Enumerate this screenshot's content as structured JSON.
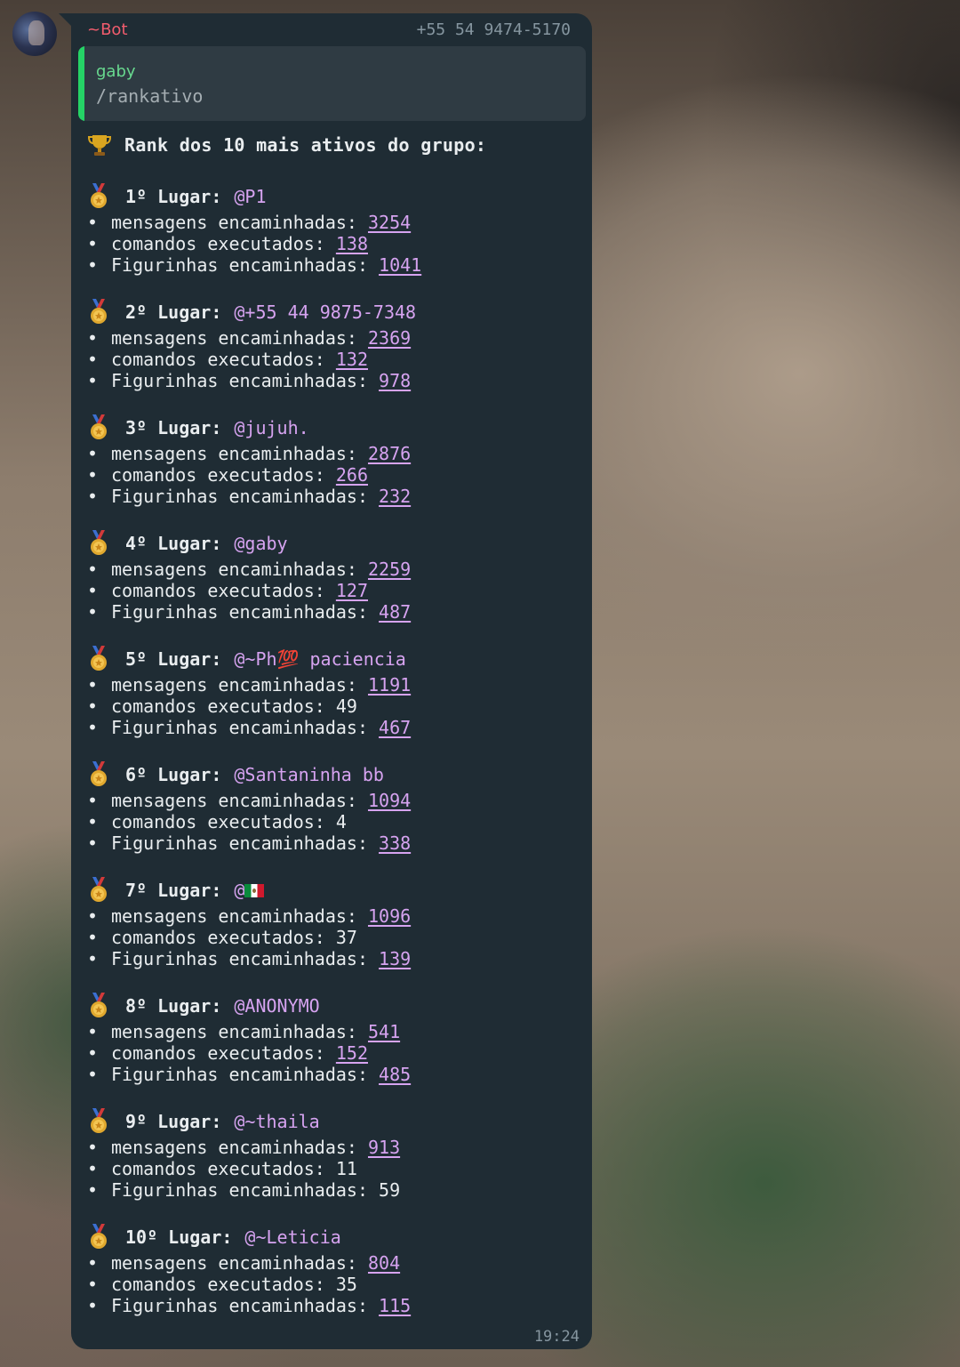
{
  "message": {
    "sender_name": "~Bot",
    "sender_phone": "+55 54 9474-5170",
    "quote": {
      "author": "gaby",
      "text": "/rankativo"
    },
    "title": "Rank dos 10 mais ativos do grupo:",
    "time": "19:24",
    "labels": {
      "messages": "mensagens encaminhadas: ",
      "commands": "comandos executados: ",
      "stickers": "Figurinhas encaminhadas: ",
      "bullet": "•"
    },
    "entries": [
      {
        "place": "1º Lugar:",
        "mention": "@P1",
        "messages": "3254",
        "commands": "138",
        "stickers": "1041"
      },
      {
        "place": "2º Lugar:",
        "mention": "@+55 44 9875-7348",
        "messages": "2369",
        "commands": "132",
        "stickers": "978"
      },
      {
        "place": "3º Lugar:",
        "mention": "@jujuh.",
        "messages": "2876",
        "commands": "266",
        "stickers": "232"
      },
      {
        "place": "4º Lugar:",
        "mention": "@gaby",
        "messages": "2259",
        "commands": "127",
        "stickers": "487"
      },
      {
        "place": "5º Lugar:",
        "mention": "@~Ph💯 paciencia",
        "messages": "1191",
        "commands": "49",
        "stickers": "467"
      },
      {
        "place": "6º Lugar:",
        "mention": "@Santaninha bb",
        "messages": "1094",
        "commands": "4",
        "stickers": "338"
      },
      {
        "place": "7º Lugar:",
        "mention": "@",
        "messages": "1096",
        "commands": "37",
        "stickers": "139"
      },
      {
        "place": "8º Lugar:",
        "mention": "@ANONYMO",
        "messages": "541",
        "commands": "152",
        "stickers": "485"
      },
      {
        "place": "9º Lugar:",
        "mention": "@~thaila",
        "messages": "913",
        "commands": "11",
        "stickers": "59"
      },
      {
        "place": "10º Lugar:",
        "mention": "@~Leticia",
        "messages": "804",
        "commands": "35",
        "stickers": "115"
      }
    ]
  },
  "colors": {
    "bubble": "#1f2c34",
    "quote_bg": "#2f3b43",
    "quote_bar": "#25d366",
    "sender_name": "#f15c6d",
    "mention": "#d6a3f0",
    "text": "#e9edef",
    "meta": "#8696a0"
  },
  "icons": {
    "title": "trophy-icon",
    "entry": "medal-icon",
    "entry_7_flag": "mexico-flag-icon"
  }
}
